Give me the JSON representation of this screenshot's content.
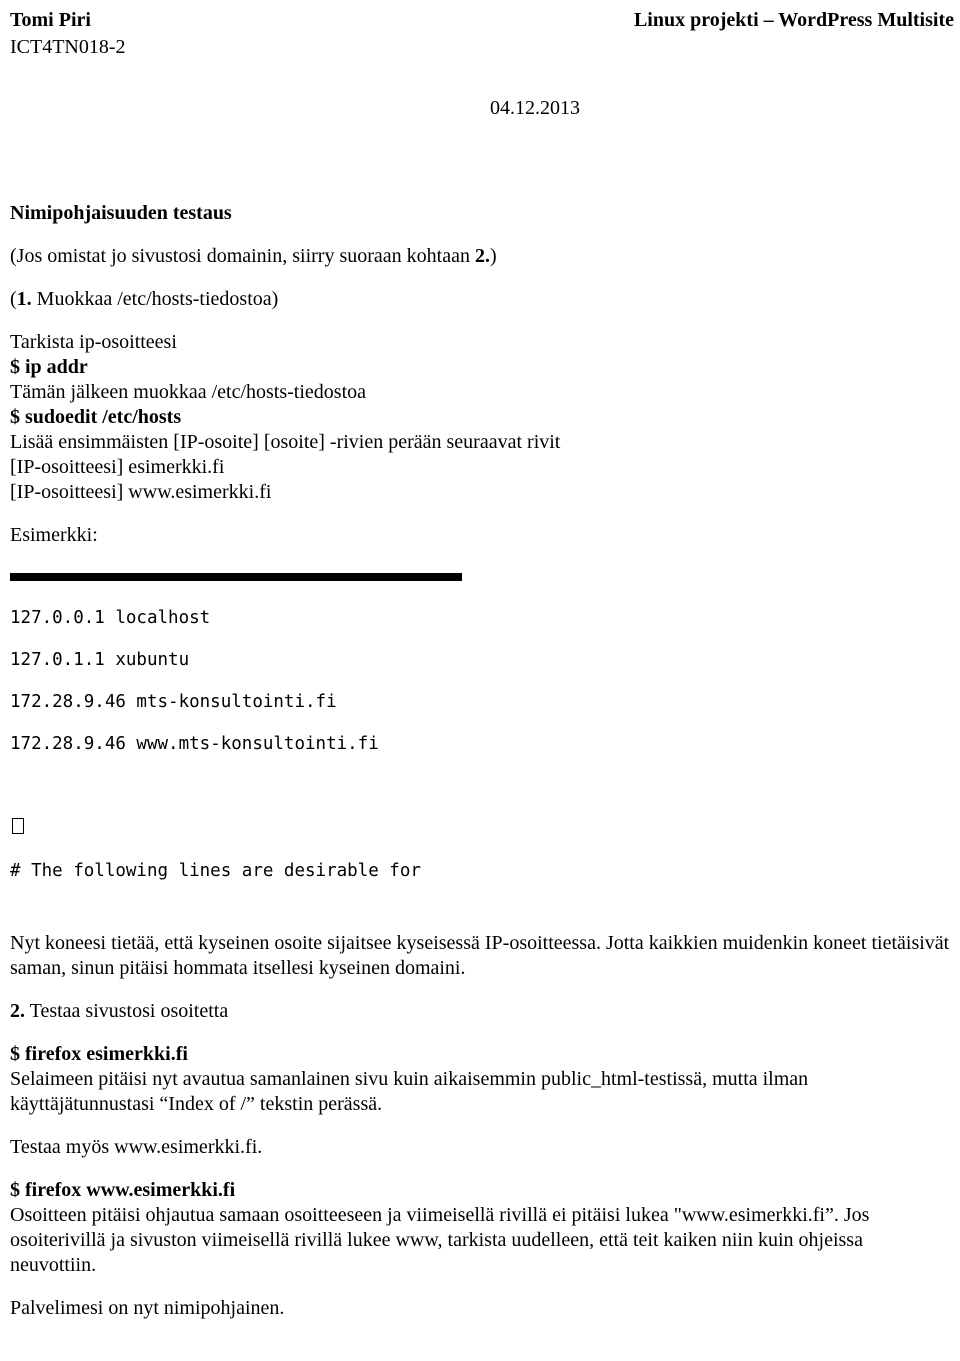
{
  "header": {
    "author": "Tomi Piri",
    "course": "ICT4TN018-2",
    "title": "Linux projekti – WordPress Multisite",
    "date": "04.12.2013"
  },
  "section": {
    "heading": "Nimipohjaisuuden testaus",
    "intro_pre": "(Jos omistat jo sivustosi domainin, siirry suoraan kohtaan ",
    "intro_bold": "2.",
    "intro_post": ")",
    "step1_pre": "(",
    "step1_bold": "1.",
    "step1_post": " Muokkaa /etc/hosts-tiedostoa)",
    "check_ip": "Tarkista ip-osoitteesi",
    "cmd_ipaddr": "$ ip addr",
    "after_ip": "Tämän jälkeen muokkaa /etc/hosts-tiedostoa",
    "cmd_sudoedit": "$ sudoedit /etc/hosts",
    "add_lines": "Lisää ensimmäisten [IP-osoite] [osoite] -rivien perään seuraavat rivit",
    "line_a": "[IP-osoitteesi] esimerkki.fi",
    "line_b": "[IP-osoitteesi] www.esimerkki.fi",
    "example_label": "Esimerkki:"
  },
  "hosts_file": {
    "l1": "127.0.0.1 localhost",
    "l2": "127.0.1.1 xubuntu",
    "l3": "172.28.9.46 mts-konsultointi.fi",
    "l4": "172.28.9.46 www.mts-konsultointi.fi",
    "l5": "# The following lines are desirable for"
  },
  "body2": {
    "p_known": "Nyt koneesi tietää, että kyseinen osoite sijaitsee kyseisessä IP-osoitteessa. Jotta kaikkien muidenkin koneet tietäisivät saman, sinun pitäisi hommata itsellesi kyseinen domaini.",
    "step2_bold": "2.",
    "step2_text": " Testaa sivustosi osoitetta",
    "cmd_firefox1": "$ firefox esimerkki.fi",
    "p_browser": "Selaimeen pitäisi nyt avautua samanlainen sivu kuin aikaisemmin public_html-testissä, mutta ilman käyttäjätunnustasi “Index of /” tekstin perässä.",
    "p_testwww": "Testaa myös www.esimerkki.fi.",
    "cmd_firefox2": "$ firefox www.esimerkki.fi",
    "p_redirect": "Osoitteen pitäisi ohjautua samaan osoitteeseen ja viimeisellä rivillä ei pitäisi lukea \"www.esimerkki.fi”. Jos osoiterivillä ja sivuston viimeisellä rivillä lukee www, tarkista uudelleen, että teit kaiken niin kuin ohjeissa neuvottiin.",
    "p_done": "Palvelimesi on nyt nimipohjainen."
  }
}
